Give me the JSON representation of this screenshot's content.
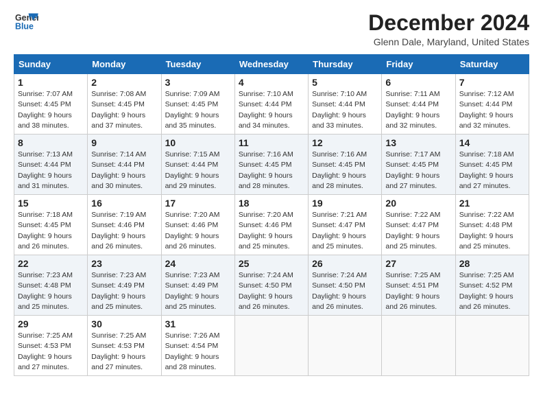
{
  "logo": {
    "line1": "General",
    "line2": "Blue"
  },
  "title": "December 2024",
  "location": "Glenn Dale, Maryland, United States",
  "header": {
    "accent_color": "#1a6bb5"
  },
  "weekdays": [
    "Sunday",
    "Monday",
    "Tuesday",
    "Wednesday",
    "Thursday",
    "Friday",
    "Saturday"
  ],
  "weeks": [
    [
      {
        "day": "1",
        "sunrise": "7:07 AM",
        "sunset": "4:45 PM",
        "daylight_hours": "9 hours",
        "daylight_minutes": "38 minutes"
      },
      {
        "day": "2",
        "sunrise": "7:08 AM",
        "sunset": "4:45 PM",
        "daylight_hours": "9 hours",
        "daylight_minutes": "37 minutes"
      },
      {
        "day": "3",
        "sunrise": "7:09 AM",
        "sunset": "4:45 PM",
        "daylight_hours": "9 hours",
        "daylight_minutes": "35 minutes"
      },
      {
        "day": "4",
        "sunrise": "7:10 AM",
        "sunset": "4:44 PM",
        "daylight_hours": "9 hours",
        "daylight_minutes": "34 minutes"
      },
      {
        "day": "5",
        "sunrise": "7:10 AM",
        "sunset": "4:44 PM",
        "daylight_hours": "9 hours",
        "daylight_minutes": "33 minutes"
      },
      {
        "day": "6",
        "sunrise": "7:11 AM",
        "sunset": "4:44 PM",
        "daylight_hours": "9 hours",
        "daylight_minutes": "32 minutes"
      },
      {
        "day": "7",
        "sunrise": "7:12 AM",
        "sunset": "4:44 PM",
        "daylight_hours": "9 hours",
        "daylight_minutes": "32 minutes"
      }
    ],
    [
      {
        "day": "8",
        "sunrise": "7:13 AM",
        "sunset": "4:44 PM",
        "daylight_hours": "9 hours",
        "daylight_minutes": "31 minutes"
      },
      {
        "day": "9",
        "sunrise": "7:14 AM",
        "sunset": "4:44 PM",
        "daylight_hours": "9 hours",
        "daylight_minutes": "30 minutes"
      },
      {
        "day": "10",
        "sunrise": "7:15 AM",
        "sunset": "4:44 PM",
        "daylight_hours": "9 hours",
        "daylight_minutes": "29 minutes"
      },
      {
        "day": "11",
        "sunrise": "7:16 AM",
        "sunset": "4:45 PM",
        "daylight_hours": "9 hours",
        "daylight_minutes": "28 minutes"
      },
      {
        "day": "12",
        "sunrise": "7:16 AM",
        "sunset": "4:45 PM",
        "daylight_hours": "9 hours",
        "daylight_minutes": "28 minutes"
      },
      {
        "day": "13",
        "sunrise": "7:17 AM",
        "sunset": "4:45 PM",
        "daylight_hours": "9 hours",
        "daylight_minutes": "27 minutes"
      },
      {
        "day": "14",
        "sunrise": "7:18 AM",
        "sunset": "4:45 PM",
        "daylight_hours": "9 hours",
        "daylight_minutes": "27 minutes"
      }
    ],
    [
      {
        "day": "15",
        "sunrise": "7:18 AM",
        "sunset": "4:45 PM",
        "daylight_hours": "9 hours",
        "daylight_minutes": "26 minutes"
      },
      {
        "day": "16",
        "sunrise": "7:19 AM",
        "sunset": "4:46 PM",
        "daylight_hours": "9 hours",
        "daylight_minutes": "26 minutes"
      },
      {
        "day": "17",
        "sunrise": "7:20 AM",
        "sunset": "4:46 PM",
        "daylight_hours": "9 hours",
        "daylight_minutes": "26 minutes"
      },
      {
        "day": "18",
        "sunrise": "7:20 AM",
        "sunset": "4:46 PM",
        "daylight_hours": "9 hours",
        "daylight_minutes": "25 minutes"
      },
      {
        "day": "19",
        "sunrise": "7:21 AM",
        "sunset": "4:47 PM",
        "daylight_hours": "9 hours",
        "daylight_minutes": "25 minutes"
      },
      {
        "day": "20",
        "sunrise": "7:22 AM",
        "sunset": "4:47 PM",
        "daylight_hours": "9 hours",
        "daylight_minutes": "25 minutes"
      },
      {
        "day": "21",
        "sunrise": "7:22 AM",
        "sunset": "4:48 PM",
        "daylight_hours": "9 hours",
        "daylight_minutes": "25 minutes"
      }
    ],
    [
      {
        "day": "22",
        "sunrise": "7:23 AM",
        "sunset": "4:48 PM",
        "daylight_hours": "9 hours",
        "daylight_minutes": "25 minutes"
      },
      {
        "day": "23",
        "sunrise": "7:23 AM",
        "sunset": "4:49 PM",
        "daylight_hours": "9 hours",
        "daylight_minutes": "25 minutes"
      },
      {
        "day": "24",
        "sunrise": "7:23 AM",
        "sunset": "4:49 PM",
        "daylight_hours": "9 hours",
        "daylight_minutes": "25 minutes"
      },
      {
        "day": "25",
        "sunrise": "7:24 AM",
        "sunset": "4:50 PM",
        "daylight_hours": "9 hours",
        "daylight_minutes": "26 minutes"
      },
      {
        "day": "26",
        "sunrise": "7:24 AM",
        "sunset": "4:50 PM",
        "daylight_hours": "9 hours",
        "daylight_minutes": "26 minutes"
      },
      {
        "day": "27",
        "sunrise": "7:25 AM",
        "sunset": "4:51 PM",
        "daylight_hours": "9 hours",
        "daylight_minutes": "26 minutes"
      },
      {
        "day": "28",
        "sunrise": "7:25 AM",
        "sunset": "4:52 PM",
        "daylight_hours": "9 hours",
        "daylight_minutes": "26 minutes"
      }
    ],
    [
      {
        "day": "29",
        "sunrise": "7:25 AM",
        "sunset": "4:53 PM",
        "daylight_hours": "9 hours",
        "daylight_minutes": "27 minutes"
      },
      {
        "day": "30",
        "sunrise": "7:25 AM",
        "sunset": "4:53 PM",
        "daylight_hours": "9 hours",
        "daylight_minutes": "27 minutes"
      },
      {
        "day": "31",
        "sunrise": "7:26 AM",
        "sunset": "4:54 PM",
        "daylight_hours": "9 hours",
        "daylight_minutes": "28 minutes"
      },
      null,
      null,
      null,
      null
    ]
  ],
  "labels": {
    "sunrise": "Sunrise:",
    "sunset": "Sunset:",
    "daylight": "Daylight:"
  }
}
